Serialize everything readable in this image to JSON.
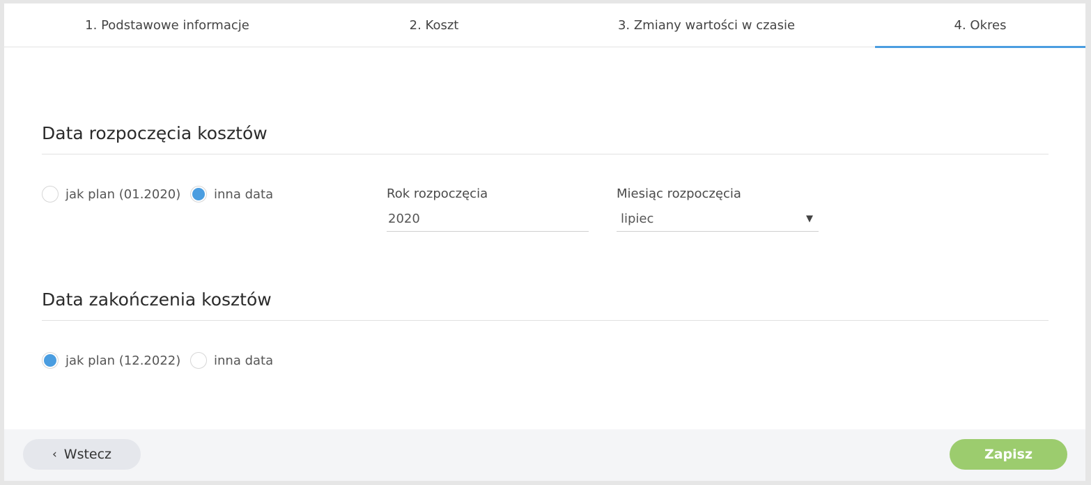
{
  "tabs": [
    {
      "label": "1. Podstawowe informacje"
    },
    {
      "label": "2. Koszt"
    },
    {
      "label": "3. Zmiany wartości w czasie"
    },
    {
      "label": "4. Okres",
      "active": true
    }
  ],
  "start_section": {
    "title": "Data rozpoczęcia kosztów",
    "options": [
      {
        "label": "jak plan (01.2020)",
        "checked": false
      },
      {
        "label": "inna data",
        "checked": true
      }
    ],
    "year_label": "Rok rozpoczęcia",
    "year_value": "2020",
    "month_label": "Miesiąc rozpoczęcia",
    "month_value": "lipiec"
  },
  "end_section": {
    "title": "Data zakończenia kosztów",
    "options": [
      {
        "label": "jak plan (12.2022)",
        "checked": true
      },
      {
        "label": "inna data",
        "checked": false
      }
    ]
  },
  "footer": {
    "back_label": "Wstecz",
    "save_label": "Zapisz"
  },
  "colors": {
    "accent": "#4a9de0",
    "save": "#9ccc6e"
  },
  "icons": {
    "back": "chevron-left-icon",
    "dropdown": "caret-down-icon"
  }
}
